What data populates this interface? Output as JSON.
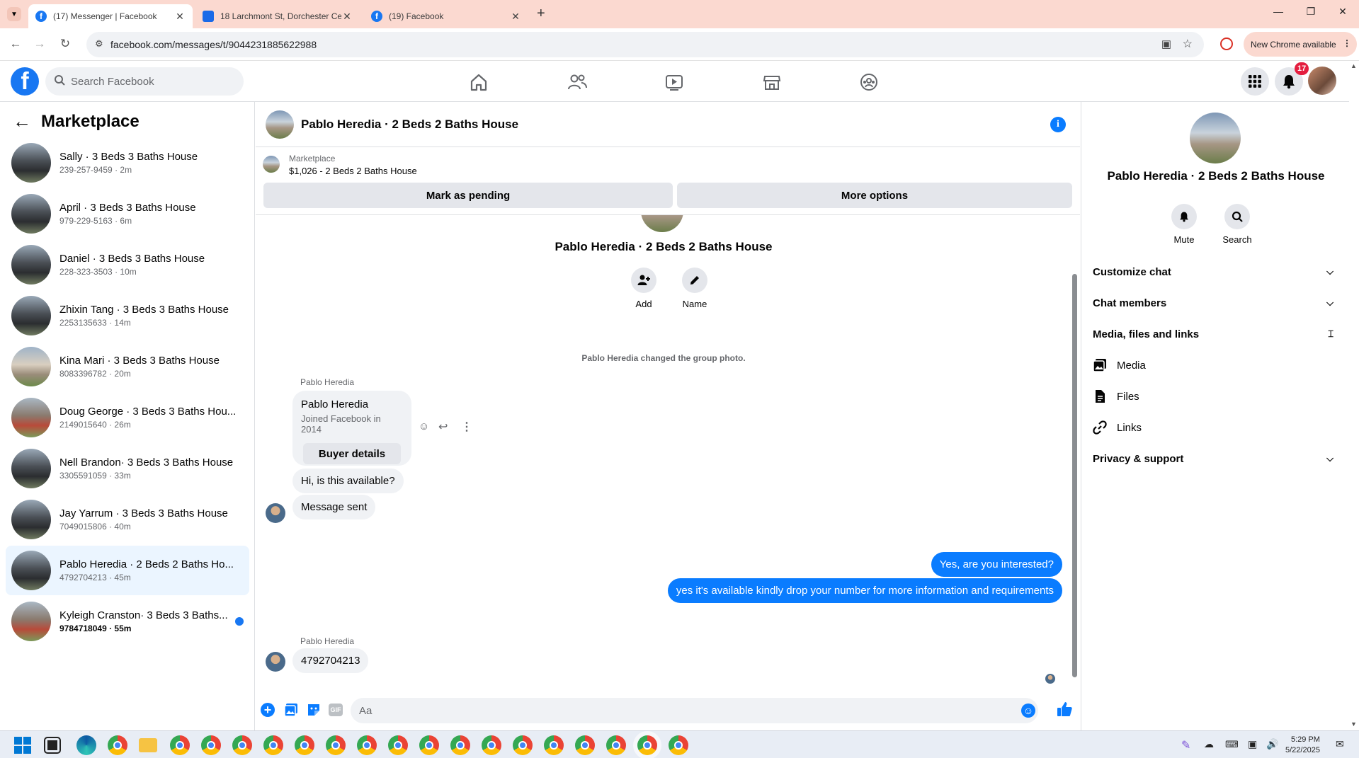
{
  "browser": {
    "tabs": [
      {
        "title": "(17) Messenger | Facebook",
        "active": true
      },
      {
        "title": "18 Larchmont St, Dorchester Ce",
        "active": false
      },
      {
        "title": "(19) Facebook",
        "active": false
      }
    ],
    "url": "facebook.com/messages/t/9044231885622988",
    "new_chrome_label": "New Chrome available"
  },
  "fb_header": {
    "search_placeholder": "Search Facebook",
    "notification_count": "17"
  },
  "sidebar": {
    "title": "Marketplace",
    "conversations": [
      {
        "name": "Sally · 3 Beds 3 Baths House",
        "sub": "239-257-9459 · 2m",
        "unread": false,
        "selected": false
      },
      {
        "name": "April · 3 Beds 3 Baths House",
        "sub": "979-229-5163 · 6m",
        "unread": false,
        "selected": false
      },
      {
        "name": "Daniel · 3 Beds 3 Baths House",
        "sub": "228-323-3503 · 10m",
        "unread": false,
        "selected": false
      },
      {
        "name": "Zhixin Tang · 3 Beds 3 Baths House",
        "sub": "2253135633 · 14m",
        "unread": false,
        "selected": false
      },
      {
        "name": "Kina Mari · 3 Beds 3 Baths House",
        "sub": "8083396782 · 20m",
        "unread": false,
        "selected": false
      },
      {
        "name": "Doug George · 3 Beds 3 Baths Hou...",
        "sub": "2149015640 · 26m",
        "unread": false,
        "selected": false
      },
      {
        "name": "Nell Brandon· 3 Beds 3 Baths House",
        "sub": "3305591059 · 33m",
        "unread": false,
        "selected": false
      },
      {
        "name": "Jay Yarrum · 3 Beds 3 Baths House",
        "sub": "7049015806 · 40m",
        "unread": false,
        "selected": false
      },
      {
        "name": "Pablo Heredia · 2 Beds 2 Baths Ho...",
        "sub": "4792704213 · 45m",
        "unread": false,
        "selected": true
      },
      {
        "name": "Kyleigh Cranston· 3 Beds 3 Baths...",
        "sub": "9784718049 · 55m",
        "unread": true,
        "selected": false
      }
    ]
  },
  "chat": {
    "title": "Pablo Heredia · 2 Beds 2 Baths House",
    "marketplace_label": "Marketplace",
    "listing": "$1,026 - 2 Beds 2 Baths House",
    "mark_pending": "Mark as pending",
    "more_options": "More options",
    "group_name": "Pablo Heredia · 2 Beds 2 Baths House",
    "add_label": "Add",
    "name_label": "Name",
    "system_msg": "Pablo Heredia changed the group photo.",
    "sender_name": "Pablo Heredia",
    "card_name": "Pablo Heredia",
    "card_joined": "Joined Facebook in 2014",
    "buyer_details": "Buyer details",
    "msg_in_1": "Hi, is this available?",
    "msg_in_2": "Message sent",
    "msg_out_1": "Yes, are you interested?",
    "msg_out_2": "yes it's available kindly drop your number for more information and requirements",
    "sender_name_2": "Pablo Heredia",
    "msg_in_3": "4792704213",
    "composer_placeholder": "Aa"
  },
  "details": {
    "name": "Pablo Heredia · 2 Beds 2 Baths House",
    "mute_label": "Mute",
    "search_label": "Search",
    "customize": "Customize chat",
    "members": "Chat members",
    "media_files": "Media, files and links",
    "media": "Media",
    "files": "Files",
    "links": "Links",
    "privacy": "Privacy & support"
  },
  "taskbar": {
    "time": "5:29 PM",
    "date": "5/22/2025"
  },
  "colors": {
    "fb_blue": "#1877f2",
    "messenger_blue": "#0a7cff",
    "tab_strip": "#fbd9d0",
    "selected_conv": "#ebf5ff"
  }
}
